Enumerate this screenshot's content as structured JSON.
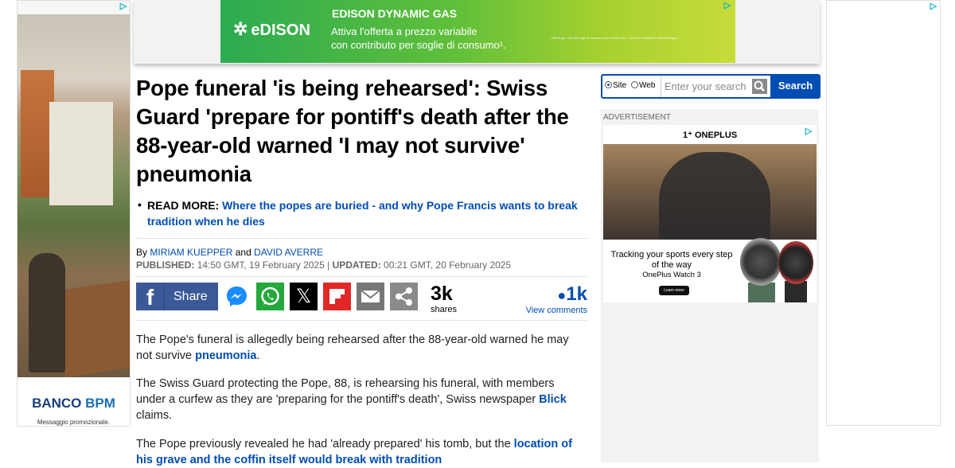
{
  "left_ad": {
    "brand1": "BANCO",
    "brand2": "BPM",
    "message": "Messaggio promozionale."
  },
  "top_ad": {
    "brand": "eDISON",
    "headline": "EDISON DYNAMIC GAS",
    "line1": "Attiva l'offerta a prezzo variabile",
    "line2": "con contributo per soglie di consumo¹.",
    "fine_print": "¹ Offerta gas - Non alle soglie di consumo annuo di 1500 Smc... Termini e condizioni su edisonenergia.it"
  },
  "article": {
    "headline": "Pope funeral 'is being rehearsed': Swiss Guard 'prepare for pontiff's death after the 88-year-old warned 'I may not survive' pneumonia",
    "readmore_label": "READ MORE:",
    "readmore_link": "Where the popes are buried - and why Pope Francis wants to break tradition when he dies",
    "by": "By",
    "author1": "MIRIAM KUEPPER",
    "and": "and",
    "author2": "DAVID AVERRE",
    "published_label": "PUBLISHED:",
    "published": "14:50 GMT, 19 February 2025",
    "updated_label": "UPDATED:",
    "updated": "00:21 GMT, 20 February 2025",
    "share_label": "Share",
    "shares_count": "3k",
    "shares_label": "shares",
    "comments_count": "1k",
    "comments_label": "View comments",
    "p1_text": "The Pope's funeral is allegedly being rehearsed after the 88-year-old warned he may not survive ",
    "p1_link": "pneumonia",
    "p1_end": ".",
    "p2_text": "The Swiss Guard protecting the Pope, 88, is rehearsing his funeral, with members under a curfew as they are 'preparing for the pontiff's death', Swiss newspaper ",
    "p2_link": "Blick",
    "p2_end": " claims.",
    "p3_text": "The Pope previously revealed he had 'already prepared' his tomb, but the ",
    "p3_link": "location of his grave and the coffin itself would break with tradition"
  },
  "search": {
    "opt_site": "Site",
    "opt_web": "Web",
    "placeholder": "Enter your search",
    "button": "Search"
  },
  "right_ad": {
    "label": "ADVERTISEMENT",
    "brand": "ONEPLUS",
    "tagline": "Tracking your sports every step of the way",
    "product": "OnePlus Watch 3",
    "cta": "Learn more"
  },
  "icons": [
    "facebook-icon",
    "messenger-icon",
    "whatsapp-icon",
    "x-icon",
    "flipboard-icon",
    "email-icon",
    "share-icon",
    "adchoices-icon",
    "search-icon"
  ],
  "colors": {
    "link": "#004db3",
    "facebook": "#3b5998",
    "whatsapp": "#25a83b",
    "flipboard": "#e12828"
  }
}
